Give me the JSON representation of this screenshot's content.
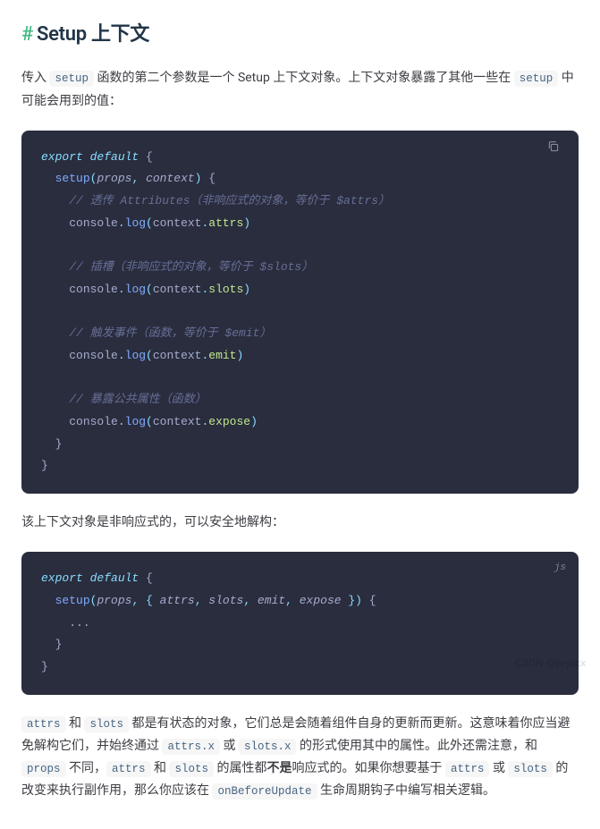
{
  "heading": {
    "hash": "#",
    "title": "Setup 上下文"
  },
  "para1": {
    "t1": "传入 ",
    "c1": "setup",
    "t2": " 函数的第二个参数是一个 Setup 上下文对象。上下文对象暴露了其他一些在 ",
    "c2": "setup",
    "t3": " 中可能会用到的值："
  },
  "code1": {
    "l1_export": "export",
    "l1_default": "default",
    "l1_brace": " {",
    "l2_setup": "setup",
    "l2_paren_open": "(",
    "l2_props": "props",
    "l2_comma": ", ",
    "l2_context": "context",
    "l2_paren_close": ")",
    "l2_brace": " {",
    "cm_attrs": "// 透传 Attributes（非响应式的对象，等价于 $attrs）",
    "log_attrs_a": "console",
    "log_attrs_dot": ".",
    "log_attrs_m": "log",
    "log_attrs_p1": "(",
    "log_attrs_ctx": "context",
    "log_attrs_d2": ".",
    "log_attrs_prop": "attrs",
    "log_attrs_p2": ")",
    "cm_slots": "// 插槽（非响应式的对象，等价于 $slots）",
    "log_slots_prop": "slots",
    "cm_emit": "// 触发事件（函数，等价于 $emit）",
    "log_emit_prop": "emit",
    "cm_expose": "// 暴露公共属性（函数）",
    "log_expose_prop": "expose",
    "close_inner": "}",
    "close_outer": "}"
  },
  "para2": "该上下文对象是非响应式的，可以安全地解构：",
  "code2": {
    "lang": "js",
    "l1_export": "export",
    "l1_default": "default",
    "l1_brace": " {",
    "l2_setup": "setup",
    "l2_open": "(",
    "l2_props": "props",
    "l2_c1": ", ",
    "l2_dbrace_open": "{ ",
    "l2_attrs": "attrs",
    "l2_c2": ", ",
    "l2_slots": "slots",
    "l2_c3": ", ",
    "l2_emit": "emit",
    "l2_c4": ", ",
    "l2_expose": "expose",
    "l2_dbrace_close": " }",
    "l2_close": ")",
    "l2_brace": " {",
    "l3_dots": "...",
    "l4_close": "}",
    "l5_close": "}"
  },
  "para3": {
    "c1": "attrs",
    "t1": " 和 ",
    "c2": "slots",
    "t2": " 都是有状态的对象，它们总是会随着组件自身的更新而更新。这意味着你应当避免解构它们，并始终通过 ",
    "c3": "attrs.x",
    "t3": " 或 ",
    "c4": "slots.x",
    "t4": " 的形式使用其中的属性。此外还需注意，和 ",
    "c5": "props",
    "t5": " 不同，",
    "c6": "attrs",
    "t6": " 和 ",
    "c7": "slots",
    "t7": " 的属性都",
    "bold": "不是",
    "t8": "响应式的。如果你想要基于 ",
    "c8": "attrs",
    "t9": " 或 ",
    "c9": "slots",
    "t10": " 的改变来执行副作用，那么你应该在 ",
    "c10": "onBeforeUpdate",
    "t11": " 生命周期钩子中编写相关逻辑。"
  },
  "watermark": "CSDN @jieyucx"
}
